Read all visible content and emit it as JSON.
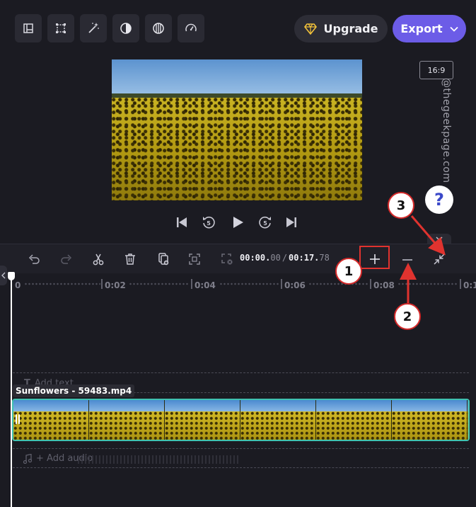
{
  "toolbar": {
    "tools": [
      {
        "name": "crop-layout-icon"
      },
      {
        "name": "resize-icon"
      },
      {
        "name": "magic-wand-icon"
      },
      {
        "name": "contrast-icon"
      },
      {
        "name": "filter-icon"
      },
      {
        "name": "speed-icon"
      }
    ],
    "upgrade_label": "Upgrade",
    "export_label": "Export",
    "upgrade_icon": "diamond-icon",
    "export_icon": "chevron-down-icon",
    "accent_color": "#6c5ce7",
    "diamond_color": "#f2c23a"
  },
  "preview": {
    "aspect_ratio": "16:9",
    "watermark": "@thegeekpage.com",
    "help_symbol": "?"
  },
  "playback": {
    "buttons": [
      "skip-to-start-icon",
      "rewind-5-icon",
      "play-icon",
      "forward-5-icon",
      "skip-to-end-icon"
    ],
    "skip_seconds": "5"
  },
  "timeline": {
    "current_time_main": "00:00.",
    "current_time_frac": "00",
    "separator": "/",
    "total_time_main": "00:17.",
    "total_time_frac": "78",
    "ruler_labels": [
      "0",
      "0:02",
      "0:04",
      "0:06",
      "0:08",
      "0:1"
    ],
    "add_text_label": "Add text",
    "clip_name": "Sunflowers - 59483.mp4",
    "add_audio_label": "+ Add audio",
    "clip_border_color": "#3fc1b0"
  },
  "annotations": {
    "badge_1": "1",
    "badge_2": "2",
    "badge_3": "3",
    "highlight_color": "#e0332f"
  }
}
